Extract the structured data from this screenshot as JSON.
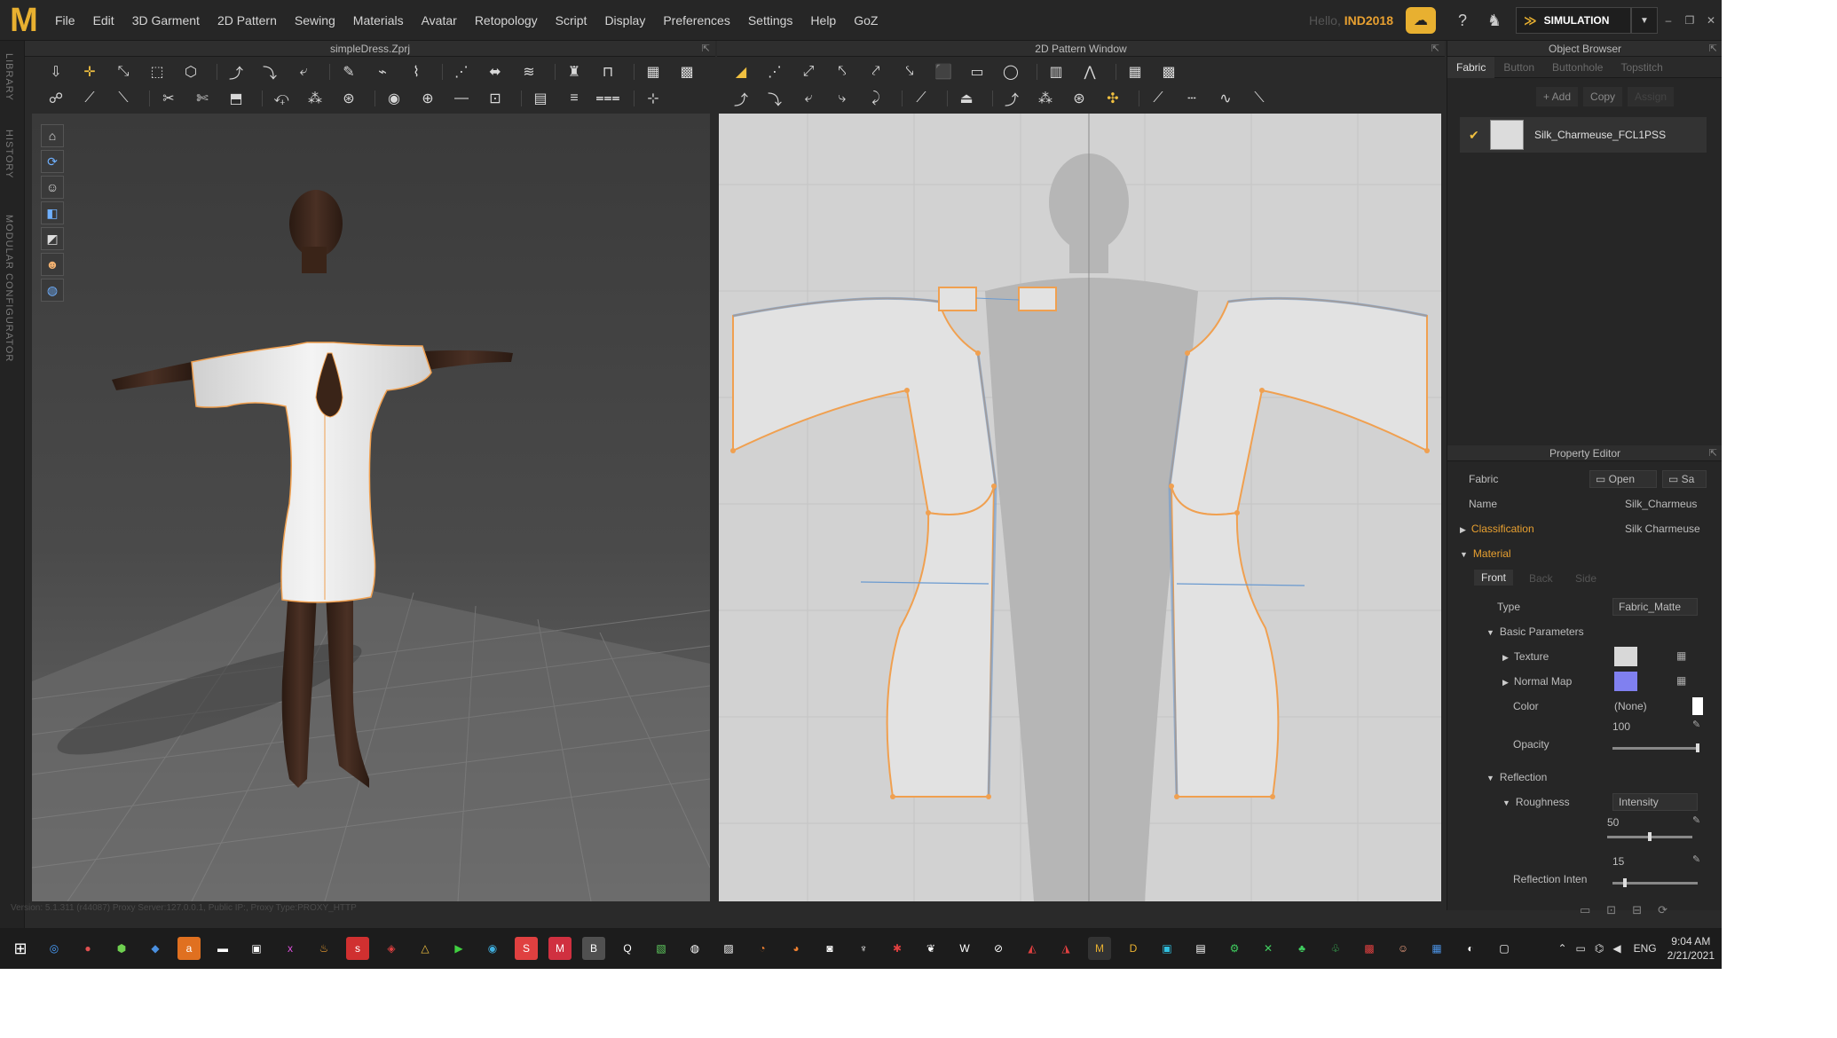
{
  "menu": {
    "logo": "M",
    "items": [
      "File",
      "Edit",
      "3D Garment",
      "2D Pattern",
      "Sewing",
      "Materials",
      "Avatar",
      "Retopology",
      "Script",
      "Display",
      "Preferences",
      "Settings",
      "Help",
      "GoZ"
    ],
    "hello_prefix": "Hello,",
    "user": "IND2018",
    "mode": "SIMULATION"
  },
  "side_tabs": [
    "LIBRARY",
    "HISTORY",
    "MODULAR CONFIGURATOR"
  ],
  "panels": {
    "viewport_3d_title": "simpleDress.Zprj",
    "viewport_2d_title": "2D Pattern Window",
    "object_browser_title": "Object Browser",
    "property_editor_title": "Property Editor"
  },
  "object_browser": {
    "tabs": [
      "Fabric",
      "Button",
      "Buttonhole",
      "Topstitch"
    ],
    "add_label": "+ Add",
    "copy_label": "Copy",
    "assign_label": "Assign",
    "fabric_name": "Silk_Charmeuse_FCL1PSS"
  },
  "property_editor": {
    "section": "Fabric",
    "open_label": "Open",
    "save_label": "Sa",
    "name_label": "Name",
    "name_value": "Silk_Charmeus",
    "classification_label": "Classification",
    "classification_value": "Silk Charmeuse",
    "material_label": "Material",
    "side_tabs": [
      "Front",
      "Back",
      "Side"
    ],
    "type_label": "Type",
    "type_value": "Fabric_Matte",
    "basic_params_label": "Basic Parameters",
    "texture_label": "Texture",
    "normal_map_label": "Normal Map",
    "color_label": "Color",
    "color_value": "(None)",
    "opacity_label": "Opacity",
    "opacity_value": "100",
    "reflection_label": "Reflection",
    "roughness_label": "Roughness",
    "roughness_mode": "Intensity",
    "roughness_value": "50",
    "reflection_intensity_label": "Reflection Inten",
    "reflection_intensity_value": "15",
    "opacity_fraction": 1.0,
    "roughness_fraction": 0.5,
    "reflection_fraction": 0.15
  },
  "status": {
    "text": "Version: 5.1.311 (r44087)     Proxy Server:127.0.0.1, Public IP:, Proxy Type:PROXY_HTTP"
  },
  "taskbar": {
    "lang": "ENG",
    "time": "9:04 AM",
    "date": "2/21/2021"
  },
  "colors": {
    "accent": "#e8a030",
    "pattern_outline": "#f0a050",
    "seam": "#6a9ad0"
  }
}
